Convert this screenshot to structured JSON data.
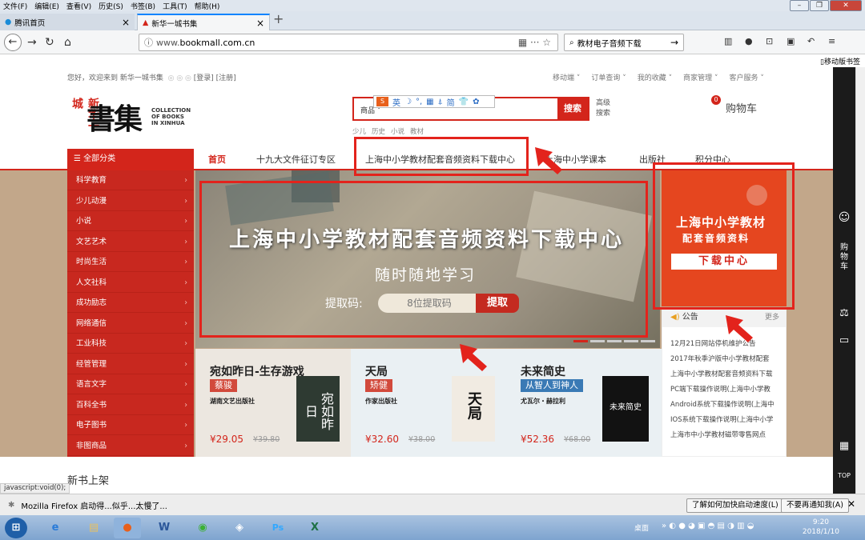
{
  "firefox": {
    "menu": [
      "文件(F)",
      "编辑(E)",
      "查看(V)",
      "历史(S)",
      "书签(B)",
      "工具(T)",
      "帮助(H)"
    ],
    "tabs": [
      {
        "label": "腾讯首页"
      },
      {
        "label": "新华一城书集"
      }
    ],
    "url_prefix": "www.",
    "url_host": "bookmall.com.cn",
    "search_value": "教材电子音频下载",
    "bookmarks_label": "移动版书签",
    "status_url": "javascript:void(0);",
    "notify_text": "Mozilla Firefox 启动得...似乎...太慢了...",
    "notify_btn1": "了解如何加快启动速度(L)",
    "notify_btn2": "不要再通知我(A)"
  },
  "site": {
    "welcome": "您好，欢迎来到 新华一城书集",
    "login_links": "[登录] [注册]",
    "top_links": [
      "移动端 ˅",
      "订单查询 ˅",
      "我的收藏 ˅",
      "商家管理 ˅",
      "客户服务 ˅"
    ],
    "logo": {
      "cn": "書集",
      "red": "新华一城",
      "en": "COLLECTION\nOF BOOKS\nIN XINHUA"
    },
    "search_select": "商品 ˅",
    "search_btn": "搜索",
    "adv_search": "高级\n搜索",
    "hot_words": [
      "少儿",
      "历史",
      "小说",
      "教材"
    ],
    "ime": {
      "s": "S",
      "items": [
        "英",
        "☽",
        "°,",
        "▦",
        "⍋",
        "简",
        "👕",
        "✿"
      ]
    },
    "cart_label": "购物车",
    "cart_count": "0",
    "all_categories": "全部分类",
    "nav": [
      "首页",
      "十九大文件征订专区",
      "上海中小学教材配套音频资料下载中心",
      "上海中小学课本",
      "出版社",
      "积分中心"
    ],
    "categories": [
      "科学教育",
      "少儿动漫",
      "小说",
      "文艺艺术",
      "时尚生活",
      "人文社科",
      "成功励志",
      "网络通信",
      "工业科技",
      "经管管理",
      "语言文字",
      "百科全书",
      "电子图书",
      "非图商品"
    ],
    "banner": {
      "title": "上海中小学教材配套音频资料下载中心",
      "subtitle": "随时随地学习",
      "code_label": "提取码:",
      "code_placeholder": "8位提取码",
      "code_btn": "提取"
    },
    "ad": {
      "line1": "上海中小学教材",
      "line2": "配套音频资料",
      "btn": "下载中心"
    },
    "notice": {
      "title": "公告",
      "more": "更多",
      "items": [
        "12月21日网站停机维护公告",
        "2017年秋季沪版中小学教材配套",
        "上海中小学教材配套音频资料下载",
        "PC端下载操作说明(上海中小学教",
        "Android系统下载操作说明(上海中",
        "IOS系统下载操作说明(上海中小学",
        "上海市中小学教材磁带零售网点"
      ]
    },
    "books": [
      {
        "title": "宛如昨日-生存游戏",
        "author": "蔡骏",
        "publisher": "湖南文艺出版社",
        "price": "¥29.05",
        "orig": "¥39.80",
        "cover": "宛如昨日",
        "tag": "#d24a3c"
      },
      {
        "title": "天局",
        "author": "矫健",
        "publisher": "作家出版社",
        "price": "¥32.60",
        "orig": "¥38.00",
        "cover": "天局",
        "tag": "#d24a3c"
      },
      {
        "title": "未来简史",
        "author": "从智人到神人",
        "publisher": "尤瓦尔・赫拉利",
        "price": "¥52.36",
        "orig": "¥68.00",
        "cover": "未来简史",
        "tag": "#3a7ab5"
      }
    ],
    "new_books": "新书上架"
  },
  "sidebar_right": [
    "购\n物\n车",
    "TOP"
  ],
  "clock": {
    "time": "9:20",
    "date": "2018/1/10"
  },
  "taskbar_desktop": "桌面"
}
